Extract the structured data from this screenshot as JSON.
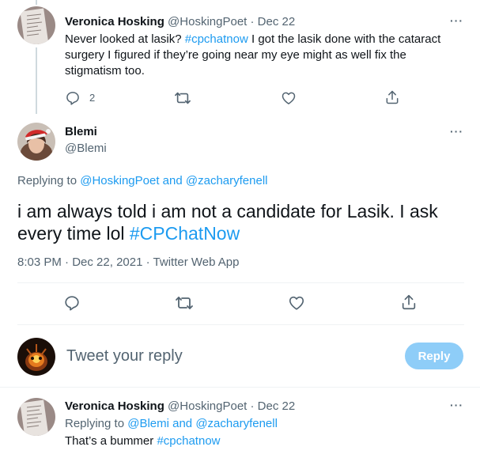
{
  "tweet1": {
    "name": "Veronica Hosking",
    "handle": "@HoskingPoet",
    "sep": "·",
    "date": "Dec 22",
    "text_a": "Never looked at lasik? ",
    "hashtag": "#cpchatnow",
    "text_b": " I got the lasik done with the cataract surgery I figured if they’re going near my eye might as well fix the stigmatism too.",
    "reply_count": "2",
    "more": "···"
  },
  "main": {
    "name": "Blemi",
    "handle": "@Blemi",
    "more": "···",
    "replying_prefix": "Replying to ",
    "replying_user1": "@HoskingPoet",
    "replying_and": " and ",
    "replying_user2": "@zacharyfenell",
    "text": "i am always told i am not a candidate for Lasik. I ask every time lol ",
    "hashtag": "#CPChatNow",
    "time": "8:03 PM",
    "sep": "·",
    "date": "Dec 22, 2021",
    "sep2": "·",
    "source": "Twitter Web App"
  },
  "compose": {
    "placeholder": "Tweet your reply",
    "button": "Reply"
  },
  "tweet3": {
    "name": "Veronica Hosking",
    "handle": "@HoskingPoet",
    "sep": "·",
    "date": "Dec 22",
    "replying_prefix": "Replying to ",
    "replying_user1": "@Blemi",
    "replying_and": " and ",
    "replying_user2": "@zacharyfenell",
    "text_a": "That’s a bummer ",
    "hashtag": "#cpchatnow",
    "more": "···"
  },
  "colors": {
    "text": "#0f1419",
    "muted": "#536471",
    "link": "#1d9bf0",
    "reply_button_disabled": "#8ecdf8"
  },
  "icons": [
    "reply-icon",
    "retweet-icon",
    "like-icon",
    "share-icon",
    "more-icon"
  ]
}
